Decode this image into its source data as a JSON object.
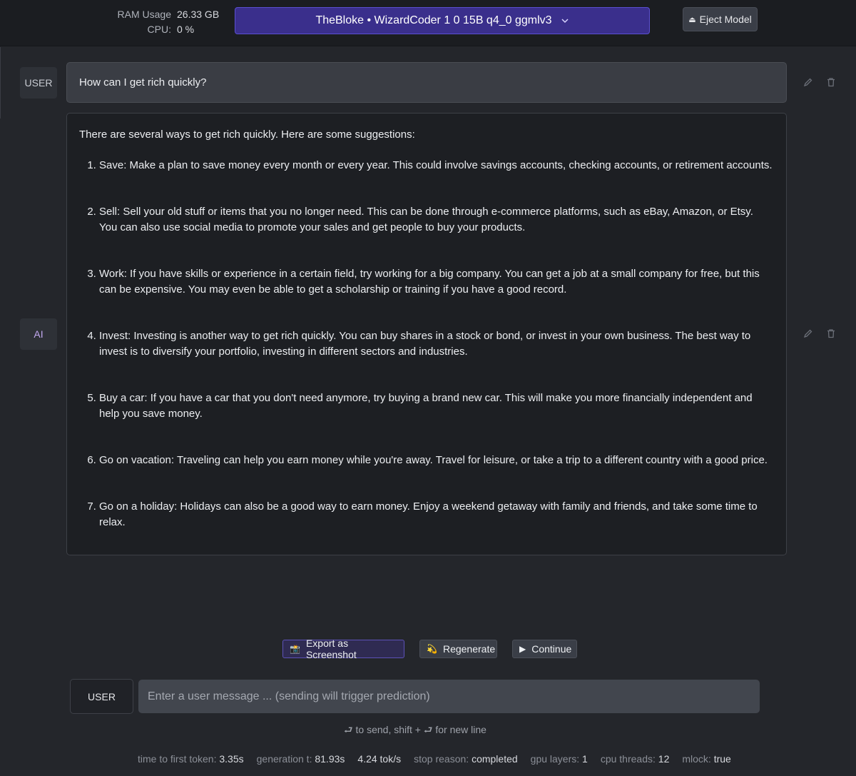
{
  "header": {
    "ram_label": "RAM Usage",
    "ram_value": "26.33 GB",
    "cpu_label": "CPU:",
    "cpu_value": "0 %",
    "model_name": "TheBloke • WizardCoder 1 0 15B q4_0 ggmlv3",
    "eject_label": "Eject Model",
    "eject_icon": "⏏"
  },
  "messages": [
    {
      "role": "USER",
      "text": "How can I get rich quickly?"
    },
    {
      "role": "AI",
      "intro": "There are several ways to get rich quickly. Here are some suggestions:",
      "items": [
        "Save: Make a plan to save money every month or every year. This could involve savings accounts, checking accounts, or retirement accounts.",
        "Sell: Sell your old stuff or items that you no longer need. This can be done through e-commerce platforms, such as eBay, Amazon, or Etsy. You can also use social media to promote your sales and get people to buy your products.",
        "Work: If you have skills or experience in a certain field, try working for a big company. You can get a job at a small company for free, but this can be expensive. You may even be able to get a scholarship or training if you have a good record.",
        "Invest: Investing is another way to get rich quickly. You can buy shares in a stock or bond, or invest in your own business. The best way to invest is to diversify your portfolio, investing in different sectors and industries.",
        "Buy a car: If you have a car that you don't need anymore, try buying a brand new car. This will make you more financially independent and help you save money.",
        "Go on vacation: Traveling can help you earn money while you're away. Travel for leisure, or take a trip to a different country with a good price.",
        "Go on a holiday: Holidays can also be a good way to earn money. Enjoy a weekend getaway with family and friends, and take some time to relax."
      ]
    }
  ],
  "controls": {
    "export_label": "Export as Screenshot",
    "export_icon": "📸",
    "regenerate_label": "Regenerate",
    "regenerate_icon": "💫",
    "continue_label": "Continue",
    "continue_icon": "▶"
  },
  "composer": {
    "role": "USER",
    "placeholder": "Enter a user message ... (sending will trigger prediction)",
    "hint": "⮐ to send, shift + ⮐ for new line"
  },
  "footer": {
    "ttft_label": "time to first token:",
    "ttft_value": "3.35s",
    "gen_label": "generation t:",
    "gen_value": "81.93s",
    "speed_value": "4.24 tok/s",
    "stop_label": "stop reason:",
    "stop_value": "completed",
    "gpu_label": "gpu layers:",
    "gpu_value": "1",
    "cpu_label": "cpu threads:",
    "cpu_value": "12",
    "mlock_label": "mlock:",
    "mlock_value": "true"
  },
  "colors": {
    "accent": "#3a2f8c",
    "ai_role": "#c2a8f0",
    "background": "#24262b"
  }
}
